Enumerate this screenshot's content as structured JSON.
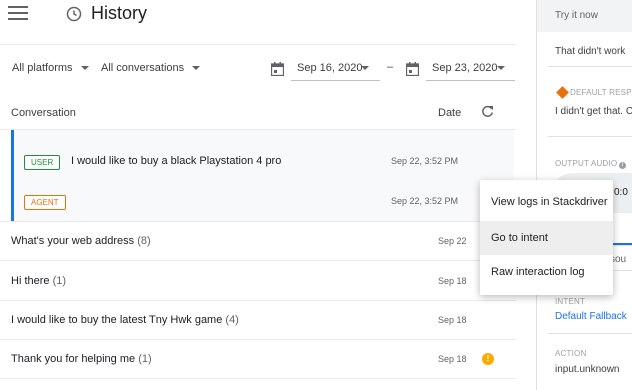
{
  "header": {
    "title": "History"
  },
  "filters": {
    "platforms": "All platforms",
    "conversations": "All conversations",
    "date_from": "Sep 16, 2020",
    "date_separator": "–",
    "date_to": "Sep 23, 2020"
  },
  "table": {
    "col_conversation": "Conversation",
    "col_date": "Date"
  },
  "expanded": {
    "user_badge": "USER",
    "agent_badge": "AGENT",
    "user_message": "I would like to buy a black Playstation 4 pro",
    "user_time": "Sep 22, 3:52 PM",
    "agent_time": "Sep 22, 3:52 PM"
  },
  "rows": [
    {
      "text": "What's your web address",
      "count": "(8)",
      "date": "Sep 22"
    },
    {
      "text": "Hi there",
      "count": "(1)",
      "date": "Sep 18"
    },
    {
      "text": "I would like to buy the latest Tny Hwk game",
      "count": "(4)",
      "date": "Sep 18"
    },
    {
      "text": "Thank you for helping me",
      "count": "(1)",
      "date": "Sep 18"
    }
  ],
  "warning_glyph": "!",
  "context_menu": {
    "items": [
      "View logs in Stackdriver",
      "Go to intent",
      "Raw interaction log"
    ]
  },
  "right_panel": {
    "try_it_now": "Try it now",
    "prompt_text": "That didn't work",
    "default_response_label": "DEFAULT RESP",
    "default_response_text": "I didn't get that. C",
    "output_audio_label": "OUTPUT AUDIO",
    "audio_time": "0:0",
    "tab_partial": "sou",
    "intent_label": "INTENT",
    "intent_value": "Default Fallback",
    "action_label": "ACTION",
    "action_value": "input.unknown"
  },
  "colors": {
    "accent": "#1a73e8",
    "user_badge": "#1e8e3e",
    "agent_badge": "#e8710a",
    "warning": "#f9ab00"
  }
}
